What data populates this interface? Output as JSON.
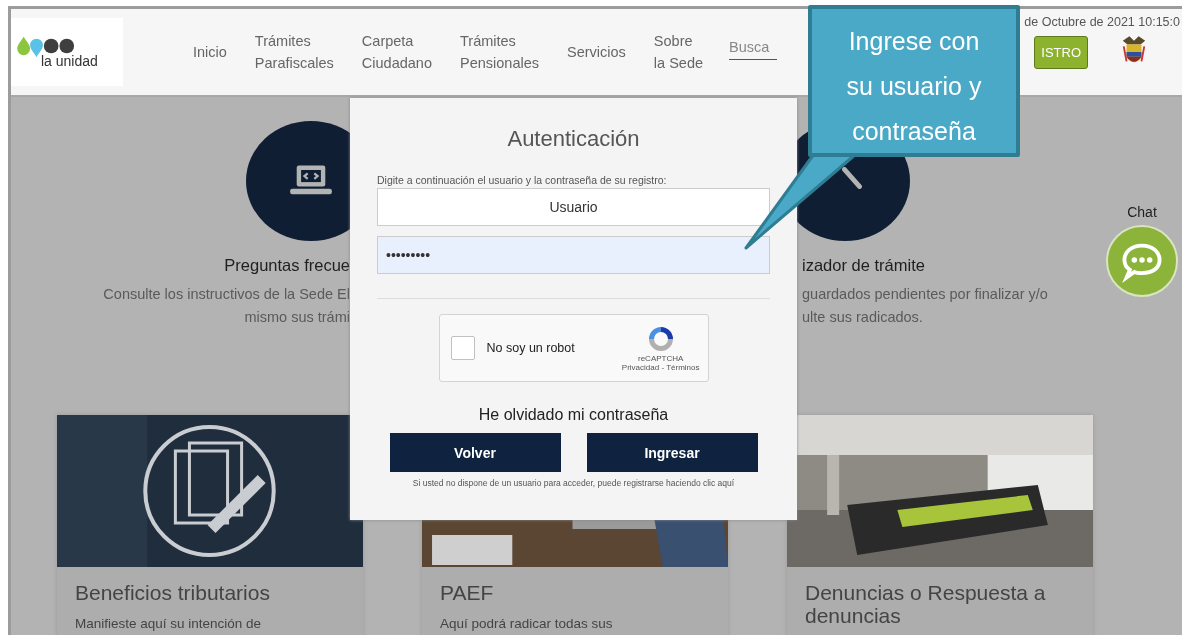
{
  "header": {
    "logo": {
      "name": "la unidad"
    },
    "nav": [
      {
        "label": "Inicio"
      },
      {
        "label": "Trámites\nParafiscales"
      },
      {
        "label": "Carpeta\nCiudadano"
      },
      {
        "label": "Trámites\nPensionales"
      },
      {
        "label": "Servicios"
      },
      {
        "label": "Sobre\nla Sede"
      }
    ],
    "search": {
      "placeholder": "Busca"
    },
    "date": "de Octubre de 2021 10:15:0",
    "register_button": "ISTRO"
  },
  "features": [
    {
      "title": "Preguntas frecue",
      "lines": [
        "Consulte los instructivos de la Sede El",
        "mismo sus trámi"
      ]
    },
    {
      "title": "izador de trámite",
      "lines": [
        "guardados pendientes por finalizar y/o",
        "ulte sus radicados."
      ]
    }
  ],
  "cards": [
    {
      "title": "Beneficios tributarios",
      "text": "Manifieste aquí su intención de"
    },
    {
      "title": "PAEF",
      "text": "Aquí podrá radicar todas sus"
    },
    {
      "title": "Denuncias o Respuesta a denuncias"
    }
  ],
  "modal": {
    "title": "Autenticación",
    "instruction": "Digite a continuación el usuario y la contraseña de su registro:",
    "user_field": {
      "value": "Usuario"
    },
    "password_field": {
      "value": "•••••••••"
    },
    "captcha": {
      "label": "No soy un robot",
      "checked": false,
      "brand": "reCAPTCHA",
      "links": "Privacidad - Términos"
    },
    "forgot_link": "He olvidado mi contraseña",
    "buttons": [
      "Volver",
      "Ingresar"
    ],
    "register_note": "Si usted no dispone de un usuario para acceder, puede registrarse haciendo clic aquí"
  },
  "callout": {
    "text": "Ingrese con su usuario y contraseña"
  },
  "chat": {
    "label": "Chat"
  }
}
